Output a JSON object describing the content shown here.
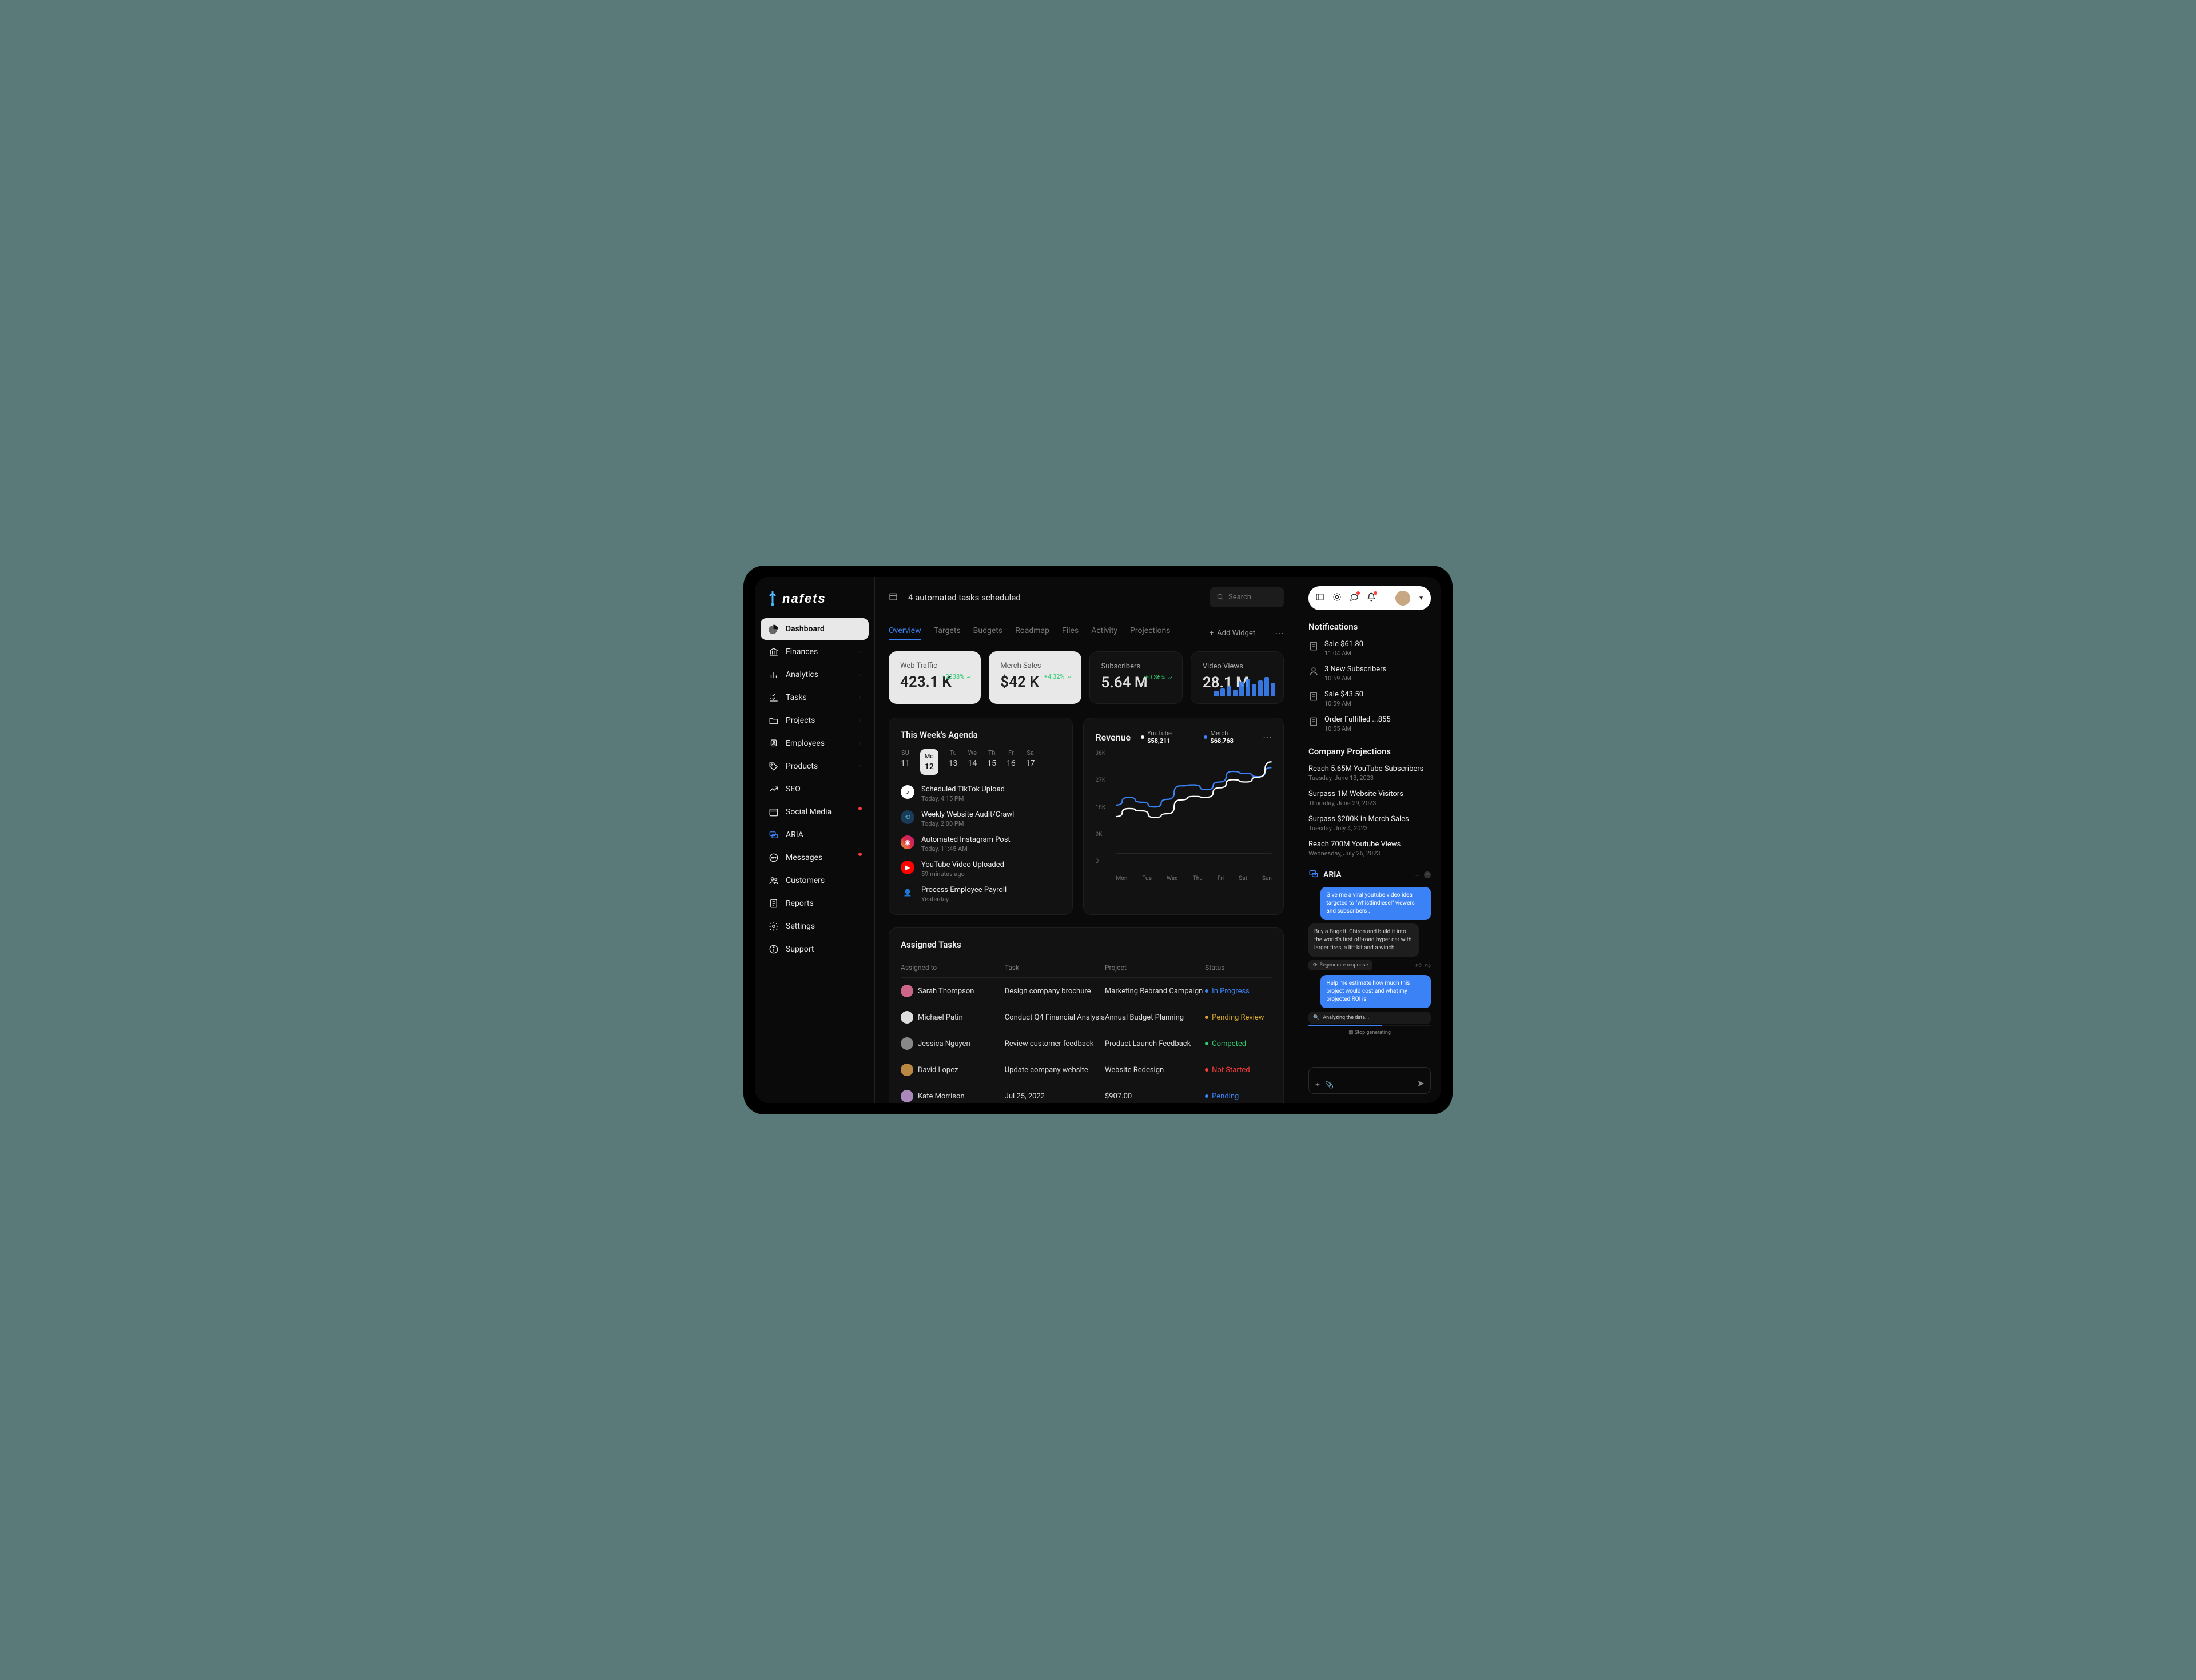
{
  "brand": "nafets",
  "header": {
    "task_text": "4 automated tasks scheduled",
    "search_placeholder": "Search"
  },
  "sidebar": {
    "items": [
      {
        "label": "Dashboard",
        "icon": "dashboard",
        "active": true
      },
      {
        "label": "Finances",
        "icon": "bank",
        "chev": true
      },
      {
        "label": "Analytics",
        "icon": "chart",
        "chev": true
      },
      {
        "label": "Tasks",
        "icon": "checklist",
        "chev": true
      },
      {
        "label": "Projects",
        "icon": "folder",
        "chev": true
      },
      {
        "label": "Employees",
        "icon": "users",
        "chev": true
      },
      {
        "label": "Products",
        "icon": "tag",
        "chev": true
      },
      {
        "label": "SEO",
        "icon": "trend"
      },
      {
        "label": "Social Media",
        "icon": "calendar",
        "dot": true
      },
      {
        "label": "ARIA",
        "icon": "chat",
        "color": "#3b82f6"
      },
      {
        "label": "Messages",
        "icon": "message",
        "dot": true
      },
      {
        "label": "Customers",
        "icon": "people"
      },
      {
        "label": "Reports",
        "icon": "report"
      },
      {
        "label": "Settings",
        "icon": "gear"
      },
      {
        "label": "Support",
        "icon": "info"
      }
    ]
  },
  "tabs": [
    "Overview",
    "Targets",
    "Budgets",
    "Roadmap",
    "Files",
    "Activity",
    "Projections"
  ],
  "active_tab": "Overview",
  "add_widget_label": "Add Widget",
  "stats": [
    {
      "label": "Web Traffic",
      "value": "423.1 K",
      "change": "+2338%",
      "variant": "light"
    },
    {
      "label": "Merch Sales",
      "value": "$42 K",
      "change": "+4.32%",
      "variant": "light"
    },
    {
      "label": "Subscribers",
      "value": "5.64 M",
      "change": "+0.36%",
      "variant": "dark"
    },
    {
      "label": "Video Views",
      "value": "28.1 M",
      "change": "",
      "variant": "dark",
      "bars": true
    }
  ],
  "agenda": {
    "title": "This Week's Agenda",
    "days": [
      {
        "name": "SU",
        "num": "11"
      },
      {
        "name": "Mo",
        "num": "12",
        "selected": true
      },
      {
        "name": "Tu",
        "num": "13"
      },
      {
        "name": "We",
        "num": "14"
      },
      {
        "name": "Th",
        "num": "15"
      },
      {
        "name": "Fr",
        "num": "16"
      },
      {
        "name": "Sa",
        "num": "17"
      }
    ],
    "items": [
      {
        "title": "Scheduled TikTok Upload",
        "time": "Today, 4:15 PM",
        "icon": "tiktok",
        "bg": "#fff",
        "fg": "#000"
      },
      {
        "title": "Weekly Website Audit/Crawl",
        "time": "Today, 2:00 PM",
        "icon": "crawl",
        "bg": "#1a3a5a",
        "fg": "#5ab"
      },
      {
        "title": "Automated Instagram Post",
        "time": "Today, 11:45 AM",
        "icon": "instagram",
        "bg": "linear-gradient(45deg,#f09433,#e6683c,#dc2743,#cc2366,#bc1888)",
        "fg": "#fff"
      },
      {
        "title": "YouTube Video Uploaded",
        "time": "59 minutes ago",
        "icon": "youtube",
        "bg": "#ff0000",
        "fg": "#fff"
      },
      {
        "title": "Process Employee Payroll",
        "time": "Yesterday",
        "icon": "payroll",
        "bg": "#111",
        "fg": "#fff"
      }
    ]
  },
  "revenue": {
    "title": "Revenue",
    "legend": [
      {
        "label": "YouTube",
        "value": "$58,211",
        "color": "#fff"
      },
      {
        "label": "Merch",
        "value": "$68,768",
        "color": "#3b82f6"
      }
    ],
    "y_ticks": [
      "36K",
      "27K",
      "18K",
      "9K",
      "0"
    ],
    "x_ticks": [
      "Mon",
      "Tue",
      "Wed",
      "Thu",
      "Fri",
      "Sat",
      "Sun"
    ]
  },
  "chart_data": {
    "type": "line",
    "title": "Revenue",
    "ylabel": "",
    "ylim": [
      0,
      36000
    ],
    "x": [
      "Mon",
      "Tue",
      "Wed",
      "Thu",
      "Fri",
      "Sat",
      "Sun"
    ],
    "series": [
      {
        "name": "YouTube",
        "color": "#ffffff",
        "values": [
          13000,
          15000,
          14000,
          20000,
          23000,
          25000,
          32000
        ]
      },
      {
        "name": "Merch",
        "color": "#3b82f6",
        "values": [
          17000,
          18000,
          19000,
          24000,
          25000,
          28000,
          30000
        ]
      }
    ]
  },
  "tasks": {
    "title": "Assigned Tasks",
    "columns": [
      "Assigned to",
      "Task",
      "Project",
      "Status"
    ],
    "rows": [
      {
        "name": "Sarah Thompson",
        "task": "Design company brochure",
        "project": "Marketing Rebrand Campaign",
        "status": "In Progress",
        "color": "#3b82f6"
      },
      {
        "name": "Michael Patin",
        "task": "Conduct Q4 Financial Analysis",
        "project": "Annual Budget Planning",
        "status": "Pending Review",
        "color": "#d4a82a"
      },
      {
        "name": "Jessica Nguyen",
        "task": "Review customer feedback",
        "project": "Product Launch Feedback",
        "status": "Competed",
        "color": "#2ecc71"
      },
      {
        "name": "David Lopez",
        "task": "Update company website",
        "project": "Website Redesign",
        "status": "Not Started",
        "color": "#ff3b3b"
      },
      {
        "name": "Kate Morrison",
        "task": "Jul 25, 2022",
        "project": "$907.00",
        "status": "Pending",
        "color": "#3b82f6"
      }
    ]
  },
  "notifications": {
    "title": "Notifications",
    "items": [
      {
        "title": "Sale $61.80",
        "time": "11:04 AM",
        "icon": "receipt"
      },
      {
        "title": "3 New Subscribers",
        "time": "10:59 AM",
        "icon": "user"
      },
      {
        "title": "Sale $43.50",
        "time": "10:59 AM",
        "icon": "receipt"
      },
      {
        "title": "Order Fulfilled ...855",
        "time": "10:55 AM",
        "icon": "receipt"
      }
    ]
  },
  "projections": {
    "title": "Company Projections",
    "items": [
      {
        "title": "Reach 5.65M YouTube Subscribers",
        "date": "Tuesday, June 13, 2023"
      },
      {
        "title": "Surpass 1M Website Visitors",
        "date": "Thursday, June 29, 2023"
      },
      {
        "title": "Surpass $200K in Merch Sales",
        "date": "Tuesday, July 4, 2023"
      },
      {
        "title": "Reach 700M Youtube Views",
        "date": "Wednesday, July 26, 2023"
      }
    ]
  },
  "aria": {
    "title": "ARIA",
    "messages": [
      {
        "role": "user",
        "text": "Give me a viral youtube video idea targeted to \"whistlindiesel\" viewers and subscribers ."
      },
      {
        "role": "ai",
        "text": "Buy a Bugatti Chiron and build it into the world's first off-road hyper car with larger tires, a lift kit and a winch"
      }
    ],
    "regenerate_label": "Regenerate response",
    "user2": "Help me estimate how much this project would cost and what my projected ROI is",
    "analyzing": "Analyzing the data...",
    "stop_label": "Stop generating"
  }
}
